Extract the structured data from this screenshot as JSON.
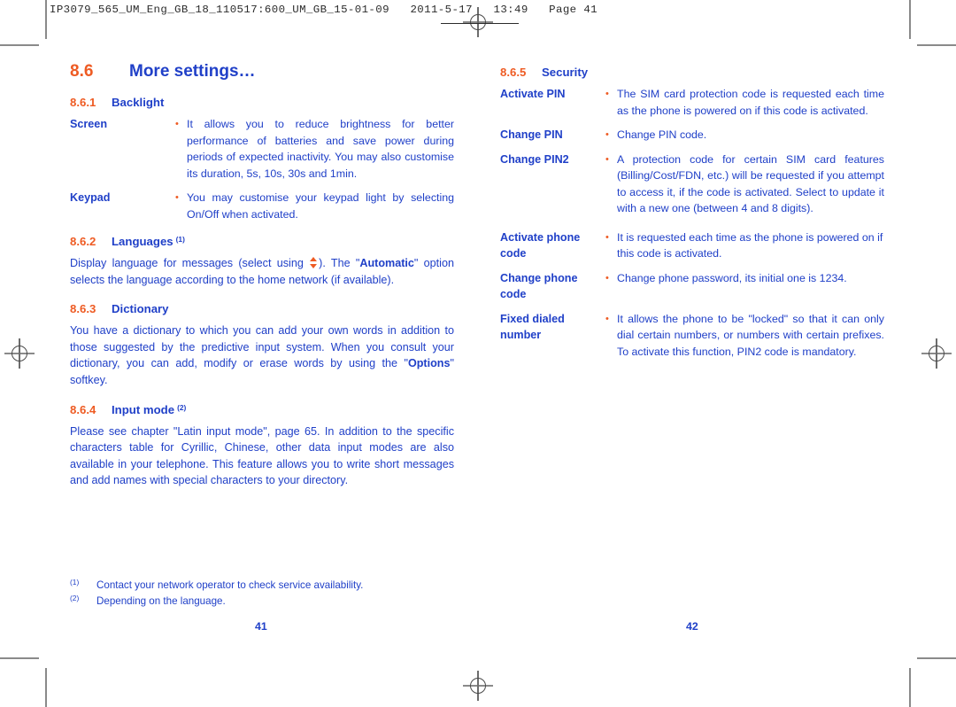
{
  "header": {
    "job_line": "IP3079_565_UM_Eng_GB_18_110517:600_UM_GB_15-01-09   2011-5-17   13:49   Page 41"
  },
  "left_column": {
    "section": {
      "number": "8.6",
      "title": "More settings…"
    },
    "subsections": [
      {
        "number": "8.6.1",
        "title": "Backlight",
        "footnote_mark": "",
        "definitions": [
          {
            "term": "Screen",
            "description": "It allows you to reduce brightness for better performance of batteries and save power during periods of expected inactivity. You may also customise its duration, 5s, 10s, 30s and 1min."
          },
          {
            "term": "Keypad",
            "description": "You may customise your keypad light by selecting On/Off when activated."
          }
        ]
      },
      {
        "number": "8.6.2",
        "title": "Languages",
        "footnote_mark": "(1)",
        "paragraph_part1": "Display language for messages (select using ",
        "paragraph_part2": "). The \"",
        "paragraph_bold": "Automatic",
        "paragraph_part3": "\" option selects the language according to the home network (if available)."
      },
      {
        "number": "8.6.3",
        "title": "Dictionary",
        "footnote_mark": "",
        "paragraph_part1": "You have a dictionary to which you can add your own words in addition to those suggested by the predictive input system. When you consult your dictionary, you can add, modify or erase words by using the \"",
        "paragraph_bold": "Options",
        "paragraph_part3": "\" softkey."
      },
      {
        "number": "8.6.4",
        "title": "Input mode",
        "footnote_mark": "(2)",
        "paragraph": "Please see chapter \"Latin input mode\", page 65. In addition to the specific characters table for Cyrillic, Chinese, other data input modes are also available in your telephone. This feature allows you to write short messages and add names with special characters to your directory."
      }
    ]
  },
  "right_column": {
    "subsection": {
      "number": "8.6.5",
      "title": "Security",
      "definitions": [
        {
          "term": "Activate PIN",
          "description": "The SIM card protection code is requested each time as the phone is powered on if this code is activated."
        },
        {
          "term": "Change PIN",
          "description": "Change PIN code."
        },
        {
          "term": "Change PIN2",
          "description": "A protection code for certain SIM card features (Billing/Cost/FDN, etc.) will be requested if you attempt to access it, if the code is activated. Select to update it with a new one (between 4 and 8 digits)."
        },
        {
          "term": "Activate phone code",
          "description": "It is requested each time as the phone is powered on if this code is activated."
        },
        {
          "term": "Change phone code",
          "description": "Change phone password, its initial one is 1234."
        },
        {
          "term": "Fixed dialed number",
          "description": "It allows the phone to be \"locked\" so that it can only dial certain numbers, or numbers with certain prefixes. To activate this function, PIN2 code is mandatory."
        }
      ]
    }
  },
  "footnotes": [
    {
      "mark": "(1)",
      "text": "Contact your network operator to check service availability."
    },
    {
      "mark": "(2)",
      "text": "Depending on the language."
    }
  ],
  "folios": {
    "left": "41",
    "right": "42"
  },
  "colors": {
    "body_blue": "#2040c8",
    "accent_orange": "#ee5b23",
    "mark_gray": "#8a8a8a"
  }
}
